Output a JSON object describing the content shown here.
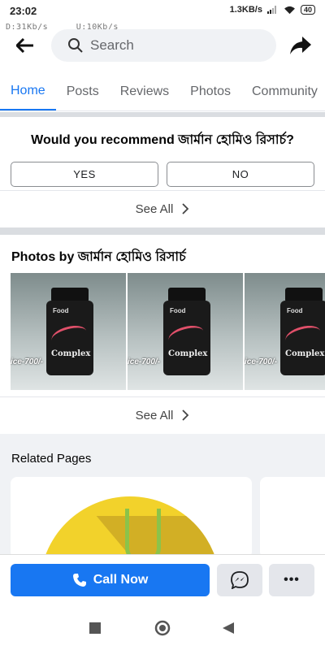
{
  "status_bar": {
    "time": "23:02",
    "net_speed": "1.3KB/s",
    "battery": "40",
    "overlay_down": "D:31Kb/s",
    "overlay_up": "U:10Kb/s"
  },
  "header": {
    "search_placeholder": "Search"
  },
  "tabs": [
    {
      "label": "Home",
      "active": true
    },
    {
      "label": "Posts",
      "active": false
    },
    {
      "label": "Reviews",
      "active": false
    },
    {
      "label": "Photos",
      "active": false
    },
    {
      "label": "Community",
      "active": false
    }
  ],
  "recommend": {
    "question": "Would you recommend জার্মান হোমিও রিসার্চ?",
    "yes_label": "YES",
    "no_label": "NO",
    "see_all": "See All"
  },
  "photos": {
    "title": "Photos by জার্মান হোমিও রিসার্চ",
    "items": [
      {
        "food": "Food",
        "name": "Complex",
        "price": "ice-700/-"
      },
      {
        "food": "Food",
        "name": "Complex",
        "price": "ice-700/-"
      },
      {
        "food": "Food",
        "name": "Complex",
        "price": "ice-700/-"
      }
    ],
    "see_all": "See All"
  },
  "related": {
    "title": "Related Pages"
  },
  "actions": {
    "call_label": "Call Now",
    "more_label": "•••"
  },
  "colors": {
    "accent": "#1877f2",
    "separator": "#dadde1"
  }
}
